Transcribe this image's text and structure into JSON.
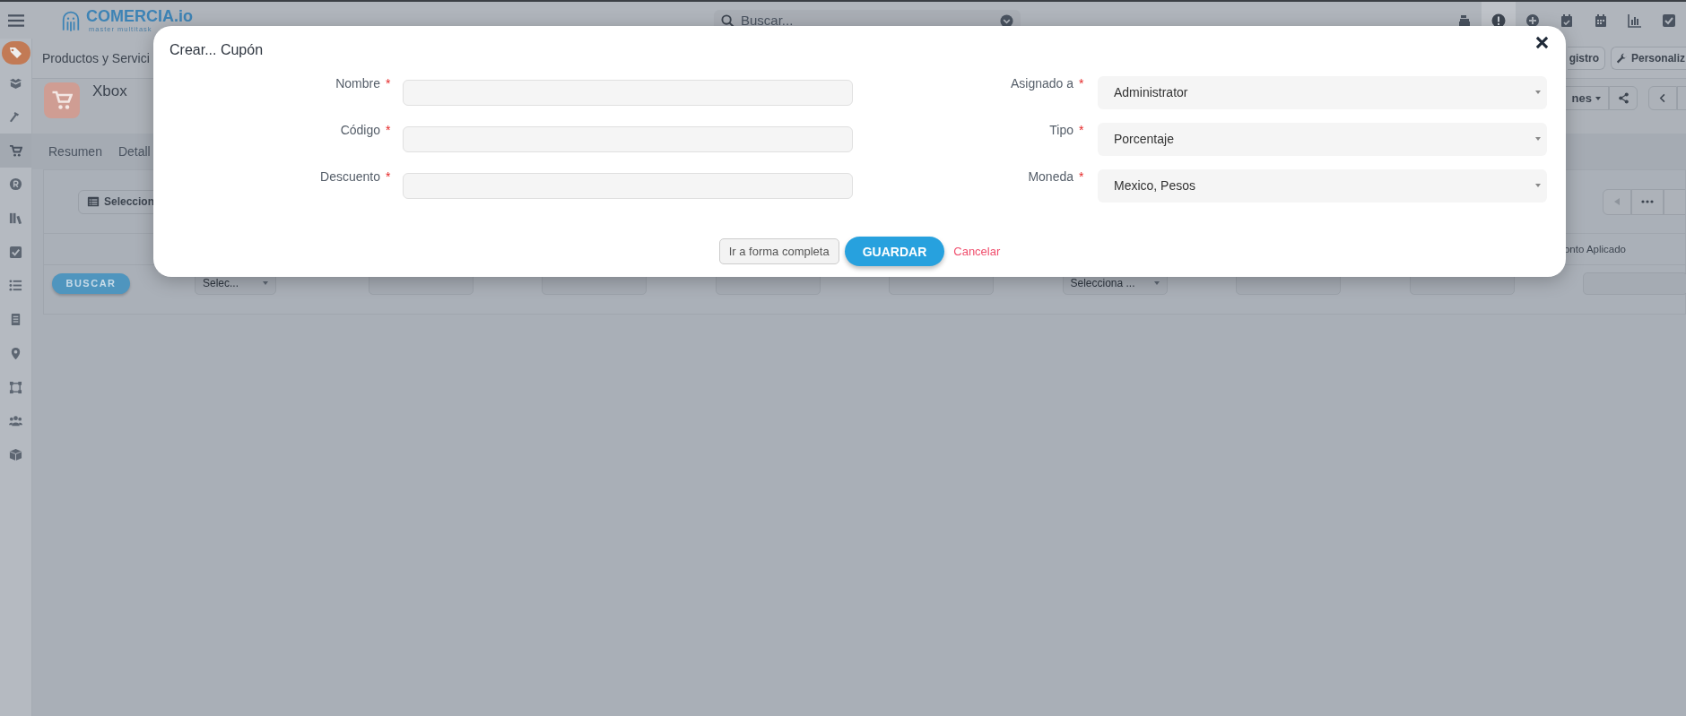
{
  "top_bar": {
    "logo_name": "COMERCIA.io",
    "logo_tagline": "master multitask",
    "search": {
      "placeholder": "Buscar..."
    },
    "icons": [
      {
        "selected": false
      },
      {
        "selected": true
      },
      {
        "selected": false
      },
      {
        "selected": false
      },
      {
        "selected": false
      },
      {
        "selected": false
      },
      {
        "selected": false
      }
    ]
  },
  "sidebar": {
    "items": [
      {
        "selected": false
      },
      {
        "selected": false
      },
      {
        "selected": true
      },
      {
        "selected": false
      },
      {
        "selected": false
      },
      {
        "selected": false
      },
      {
        "selected": false
      },
      {
        "selected": false
      },
      {
        "selected": false
      },
      {
        "selected": false
      },
      {
        "selected": false
      },
      {
        "selected": false
      }
    ]
  },
  "module": {
    "title": "Productos y Servici",
    "buttons": [
      "gistro",
      "Personaliz"
    ]
  },
  "record": {
    "title": "Xbox",
    "actions_button": "nes",
    "tabs": [
      "Resumen",
      "Detall"
    ]
  },
  "list": {
    "select_button": "Seleccion",
    "search_button": "BUSCAR",
    "column_header": "onto Aplicado",
    "filters": [
      {
        "kind": "select",
        "value": "Selec..."
      },
      {
        "kind": "input"
      },
      {
        "kind": "input"
      },
      {
        "kind": "input"
      },
      {
        "kind": "input"
      },
      {
        "kind": "select",
        "value": "Selecciona ..."
      },
      {
        "kind": "input"
      },
      {
        "kind": "input"
      },
      {
        "kind": "input"
      }
    ]
  },
  "dialog": {
    "title": "Crear... Cupón",
    "left_fields": [
      {
        "label": "Nombre",
        "required_mark": "*"
      },
      {
        "label": "Código",
        "required_mark": "*"
      },
      {
        "label": "Descuento",
        "required_mark": "*"
      }
    ],
    "right_fields": [
      {
        "label": "Asignado a",
        "required_mark": "*",
        "value": "Administrator"
      },
      {
        "label": "Tipo",
        "required_mark": "*",
        "value": "Porcentaje"
      },
      {
        "label": "Moneda",
        "required_mark": "*",
        "value": "Mexico, Pesos"
      }
    ],
    "buttons": {
      "full_form": "Ir a forma completa",
      "save": "GUARDAR",
      "cancel": "Cancelar"
    }
  }
}
